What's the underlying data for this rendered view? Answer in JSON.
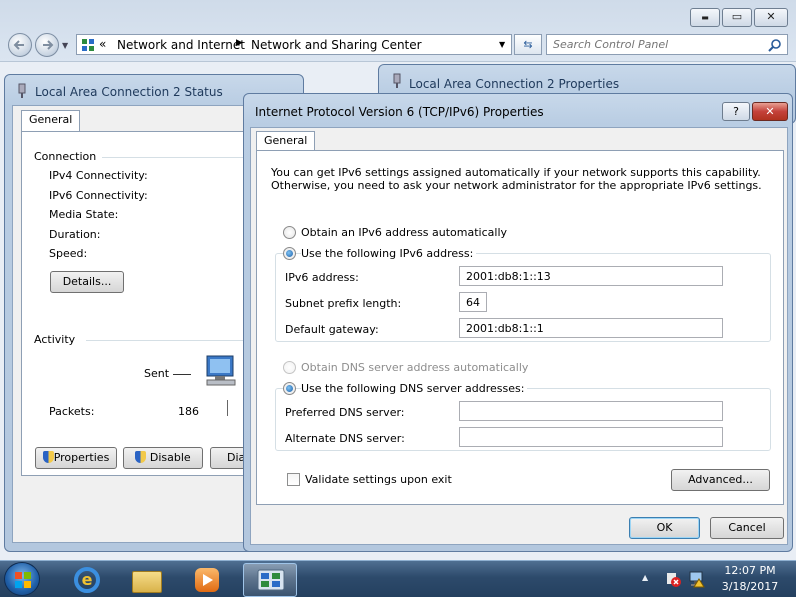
{
  "explorer": {
    "breadcrumb_sep0": "«",
    "breadcrumb": [
      "Network and Internet",
      "Network and Sharing Center"
    ],
    "search_placeholder": "Search Control Panel",
    "caption_min": "▬",
    "caption_max": "▭",
    "caption_close": "✕"
  },
  "status_window": {
    "title": "Local Area Connection 2 Status",
    "tab": "General",
    "connection_group": "Connection",
    "fields": [
      "IPv4 Connectivity:",
      "IPv6 Connectivity:",
      "Media State:",
      "Duration:",
      "Speed:"
    ],
    "details_button": "Details...",
    "activity_group": "Activity",
    "sent_label": "Sent",
    "packets_label": "Packets:",
    "packets_sent": "186",
    "buttons": {
      "properties": "Properties",
      "disable": "Disable",
      "diagnose": "Diag"
    }
  },
  "props_window": {
    "title": "Local Area Connection 2 Properties"
  },
  "ipv6_dialog": {
    "title": "Internet Protocol Version 6 (TCP/IPv6) Properties",
    "help_button": "?",
    "close_button": "✕",
    "tab": "General",
    "intro_line1": "You can get IPv6 settings assigned automatically if your network supports this capability.",
    "intro_line2": "Otherwise, you need to ask your network administrator for the appropriate IPv6 settings.",
    "radio_auto_ip": "Obtain an IPv6 address automatically",
    "radio_static_ip": "Use the following IPv6 address:",
    "ipv6_address_label": "IPv6 address:",
    "ipv6_address_value": "2001:db8:1::13",
    "prefix_label": "Subnet prefix length:",
    "prefix_value": "64",
    "gateway_label": "Default gateway:",
    "gateway_value": "2001:db8:1::1",
    "radio_auto_dns": "Obtain DNS server address automatically",
    "radio_static_dns": "Use the following DNS server addresses:",
    "preferred_dns_label": "Preferred DNS server:",
    "preferred_dns_value": "",
    "alternate_dns_label": "Alternate DNS server:",
    "alternate_dns_value": "",
    "validate_label": "Validate settings upon exit",
    "advanced_button": "Advanced...",
    "ok_button": "OK",
    "cancel_button": "Cancel"
  },
  "taskbar": {
    "time": "12:07 PM",
    "date": "3/18/2017",
    "tray_arrow": "▲"
  },
  "colors": {
    "accent": "#1e395b",
    "taskbar": "#2d4a6b",
    "close_red": "#c4413a"
  }
}
